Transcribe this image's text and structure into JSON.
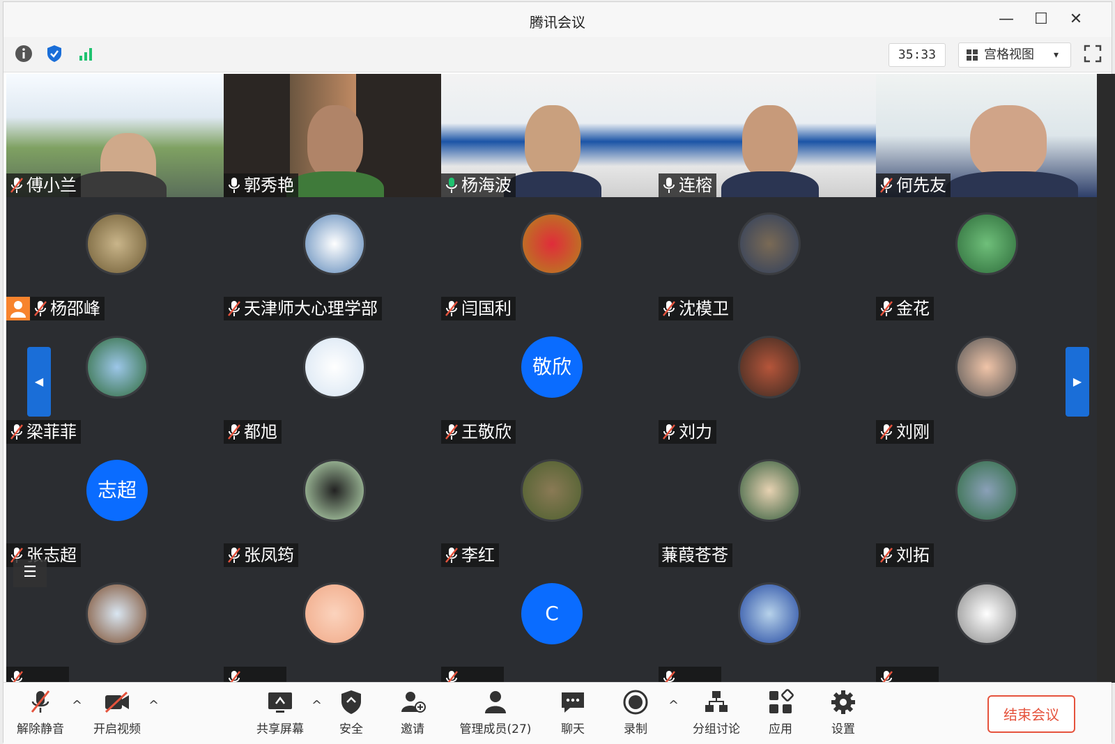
{
  "window": {
    "title": "腾讯会议",
    "minimize": "—",
    "maximize": "☐",
    "close": "✕"
  },
  "toolbar": {
    "timer": "35:33",
    "view_label": "宫格视图",
    "view_caret": "▾"
  },
  "colors": {
    "accent": "#0a6cff",
    "end": "#e5533d",
    "speaking": "#1fc270",
    "host_badge": "#f7832d"
  },
  "participants": [
    {
      "name": "傅小兰",
      "mic": "muted"
    },
    {
      "name": "郭秀艳",
      "mic": "on"
    },
    {
      "name": "杨海波",
      "mic": "on",
      "speaking": true
    },
    {
      "name": "连榕",
      "mic": "on"
    },
    {
      "name": "何先友",
      "mic": "muted"
    },
    {
      "name": "杨邵峰",
      "mic": "muted",
      "host": true
    },
    {
      "name": "天津师大心理学部",
      "mic": "muted"
    },
    {
      "name": "闫国利",
      "mic": "muted"
    },
    {
      "name": "沈模卫",
      "mic": "muted"
    },
    {
      "name": "金花",
      "mic": "muted"
    },
    {
      "name": "梁菲菲",
      "mic": "muted"
    },
    {
      "name": "都旭",
      "mic": "muted"
    },
    {
      "name": "王敬欣",
      "mic": "muted",
      "avatar_text": "敬欣"
    },
    {
      "name": "刘力",
      "mic": "muted"
    },
    {
      "name": "刘刚",
      "mic": "muted"
    },
    {
      "name": "张志超",
      "mic": "muted",
      "avatar_text": "志超"
    },
    {
      "name": "张凤筠",
      "mic": "muted"
    },
    {
      "name": "李红",
      "mic": "muted"
    },
    {
      "name": "蒹葭苍苍",
      "mic": "none"
    },
    {
      "name": "刘拓",
      "mic": "muted"
    },
    {
      "name": "",
      "mic": "muted"
    },
    {
      "name": "",
      "mic": "muted"
    },
    {
      "name": "",
      "mic": "muted",
      "avatar_text": "C"
    },
    {
      "name": "",
      "mic": "muted"
    },
    {
      "name": "",
      "mic": "muted"
    }
  ],
  "pager": {
    "left": "◀",
    "right": "▶"
  },
  "list_button": "☰",
  "bottom": {
    "unmute": "解除静音",
    "start_video": "开启视频",
    "share_screen": "共享屏幕",
    "security": "安全",
    "invite": "邀请",
    "manage_members": "管理成员(27)",
    "chat": "聊天",
    "record": "录制",
    "breakout": "分组讨论",
    "apps": "应用",
    "settings": "设置",
    "end_meeting": "结束会议",
    "caret": "^"
  }
}
